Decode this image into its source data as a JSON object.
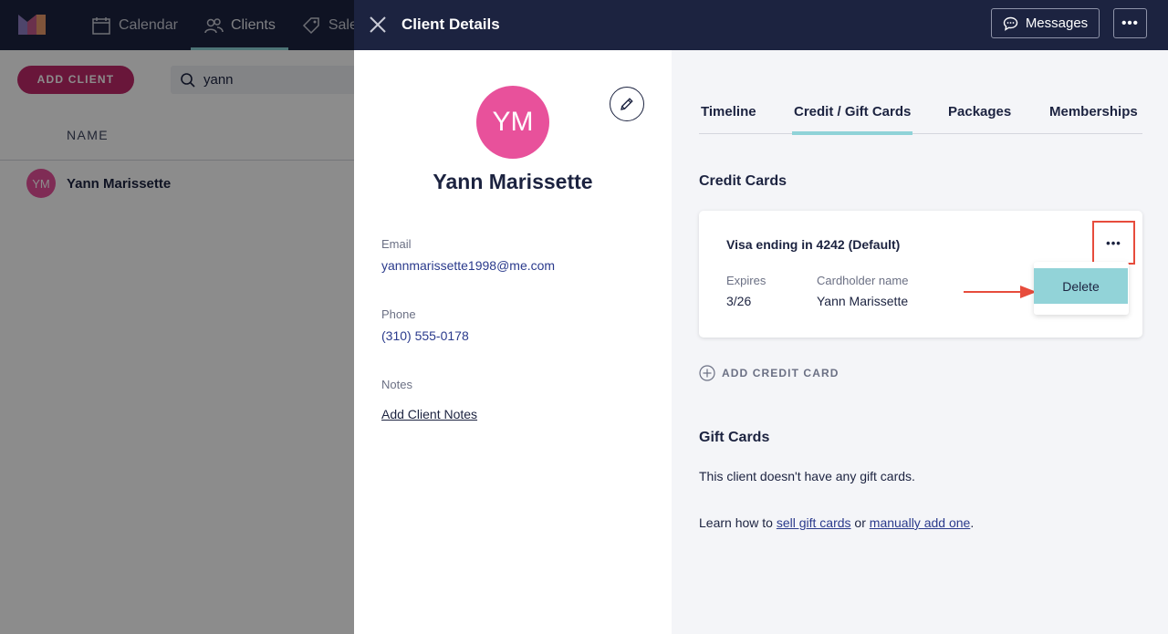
{
  "app": {
    "nav": [
      {
        "label": "Calendar",
        "icon": "calendar-icon",
        "active": false
      },
      {
        "label": "Clients",
        "icon": "users-icon",
        "active": true
      },
      {
        "label": "Sales",
        "icon": "tag-icon",
        "active": false
      }
    ],
    "add_client_label": "ADD CLIENT",
    "search": {
      "value": "yann"
    },
    "table": {
      "header": "NAME",
      "rows": [
        {
          "initials": "YM",
          "name": "Yann Marissette"
        }
      ]
    }
  },
  "drawer": {
    "title": "Client Details",
    "messages_label": "Messages",
    "more_label": "•••",
    "client": {
      "initials": "YM",
      "name": "Yann Marissette",
      "email_label": "Email",
      "email": "yannmarissette1998@me.com",
      "phone_label": "Phone",
      "phone": "(310) 555-0178",
      "notes_label": "Notes",
      "notes_link": "Add Client Notes"
    },
    "tabs": [
      "Timeline",
      "Credit / Gift Cards",
      "Packages",
      "Memberships"
    ],
    "active_tab": "Credit / Gift Cards",
    "credit_cards": {
      "title": "Credit Cards",
      "card": {
        "title": "Visa ending in 4242 (Default)",
        "expires_label": "Expires",
        "expires": "3/26",
        "holder_label": "Cardholder name",
        "holder": "Yann Marissette",
        "more_label": "•••"
      },
      "dropdown": {
        "delete_label": "Delete"
      },
      "add_label": "ADD CREDIT CARD"
    },
    "gift_cards": {
      "title": "Gift Cards",
      "empty_text": "This client doesn't have any gift cards.",
      "learn_prefix": "Learn how to ",
      "sell_link": "sell gift cards",
      "or_text": " or ",
      "manual_link": "manually add one",
      "suffix": "."
    }
  },
  "colors": {
    "navy": "#1c2340",
    "accent_pink": "#e8519b",
    "add_client_bg": "#c0286a",
    "tab_underline": "#8fd3d8",
    "highlight_red": "#e74c3c"
  }
}
